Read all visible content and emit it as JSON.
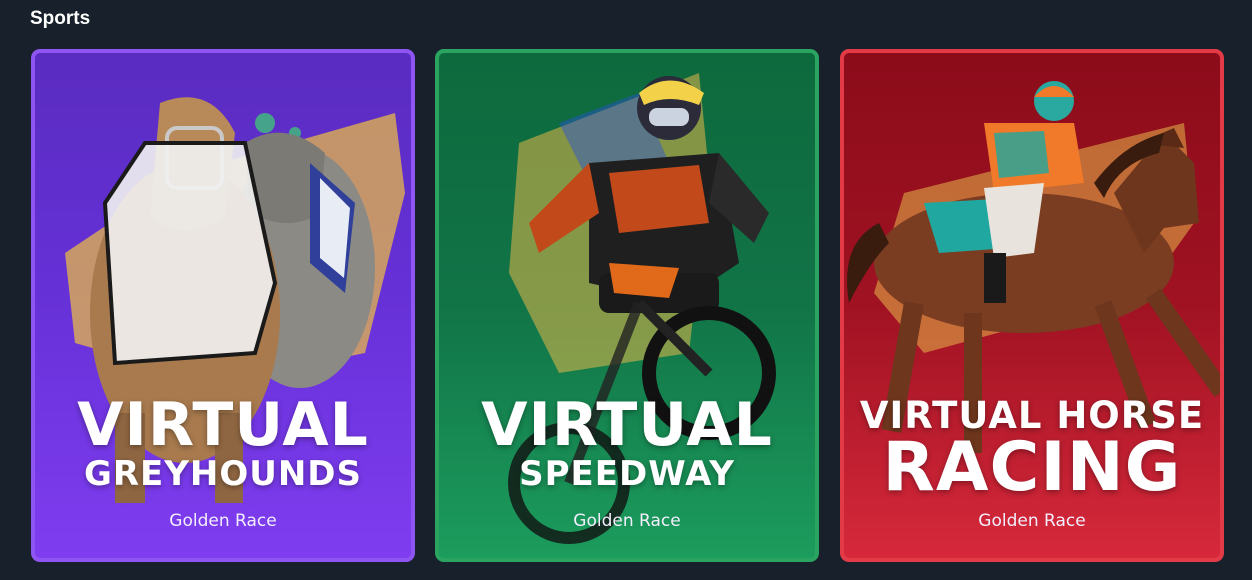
{
  "section": {
    "title": "Sports"
  },
  "cards": [
    {
      "line1": "VIRTUAL",
      "line2": "GREYHOUNDS",
      "provider": "Golden Race",
      "color": "#7f3df0"
    },
    {
      "line1": "VIRTUAL",
      "line2": "SPEEDWAY",
      "provider": "Golden Race",
      "color": "#1c9c5d"
    },
    {
      "line1": "VIRTUAL HORSE",
      "line2": "RACING",
      "provider": "Golden Race",
      "color": "#d6293b"
    }
  ]
}
